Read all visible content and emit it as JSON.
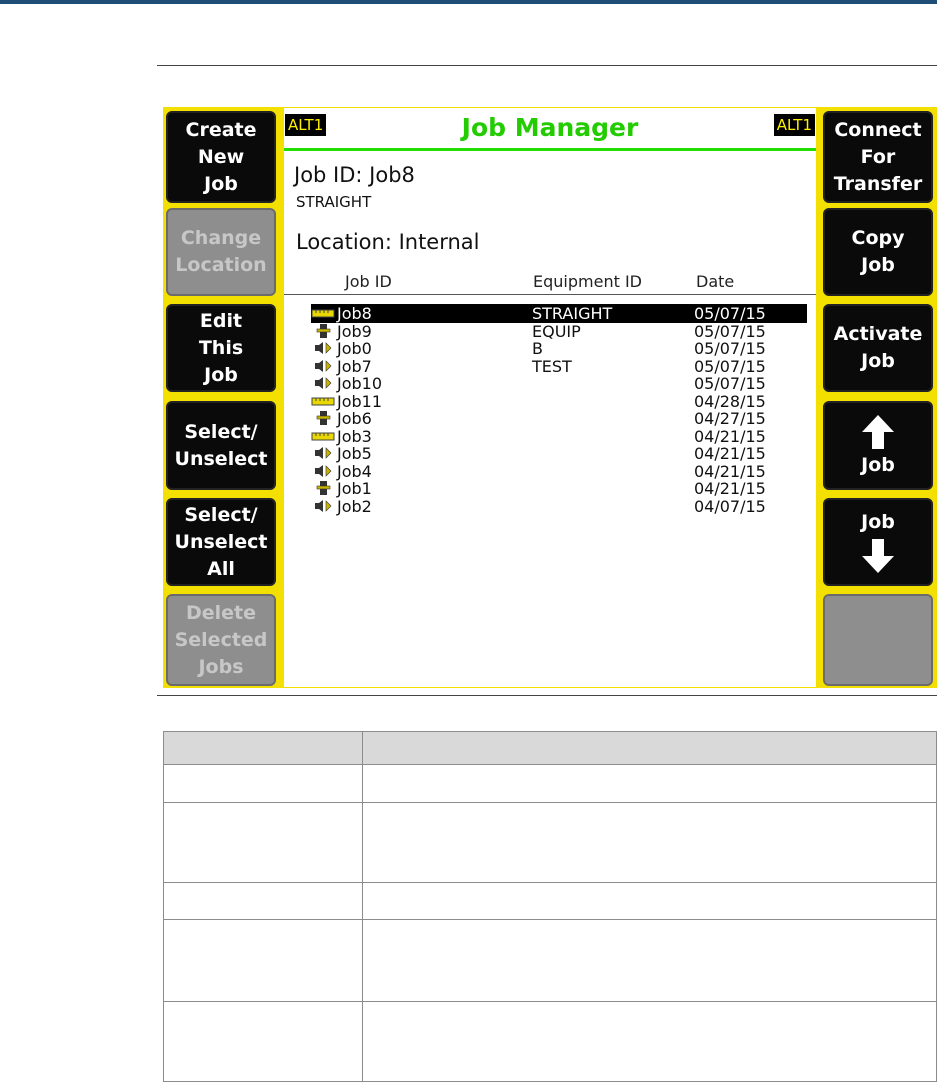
{
  "screen": {
    "alt_left": "ALT1",
    "alt_right": "ALT1",
    "title": "Job Manager",
    "job_id": "Job ID: Job8",
    "equipment": "STRAIGHT",
    "location": "Location: Internal",
    "columns": {
      "job_id": "Job ID",
      "equipment_id": "Equipment ID",
      "date": "Date"
    },
    "jobs": [
      {
        "name": "Job8",
        "equipment": "STRAIGHT",
        "date": "05/07/15",
        "icon": "ruler-icon",
        "selected": true
      },
      {
        "name": "Job9",
        "equipment": "EQUIP",
        "date": "05/07/15",
        "icon": "probe-icon",
        "selected": false
      },
      {
        "name": "Job0",
        "equipment": "B",
        "date": "05/07/15",
        "icon": "speaker-icon",
        "selected": false
      },
      {
        "name": "Job7",
        "equipment": "TEST",
        "date": "05/07/15",
        "icon": "speaker-icon",
        "selected": false
      },
      {
        "name": "Job10",
        "equipment": "",
        "date": "05/07/15",
        "icon": "speaker-icon",
        "selected": false
      },
      {
        "name": "Job11",
        "equipment": "",
        "date": "04/28/15",
        "icon": "ruler-icon",
        "selected": false
      },
      {
        "name": "Job6",
        "equipment": "",
        "date": "04/27/15",
        "icon": "probe-icon",
        "selected": false
      },
      {
        "name": "Job3",
        "equipment": "",
        "date": "04/21/15",
        "icon": "ruler-icon",
        "selected": false
      },
      {
        "name": "Job5",
        "equipment": "",
        "date": "04/21/15",
        "icon": "speaker-icon",
        "selected": false
      },
      {
        "name": "Job4",
        "equipment": "",
        "date": "04/21/15",
        "icon": "speaker-icon",
        "selected": false
      },
      {
        "name": "Job1",
        "equipment": "",
        "date": "04/21/15",
        "icon": "probe-icon",
        "selected": false
      },
      {
        "name": "Job2",
        "equipment": "",
        "date": "04/07/15",
        "icon": "speaker-icon",
        "selected": false
      }
    ]
  },
  "left_keys": {
    "create_new_job": [
      "Create",
      "New",
      "Job"
    ],
    "change_location": [
      "Change",
      "Location"
    ],
    "edit_this_job": [
      "Edit",
      "This",
      "Job"
    ],
    "select_unselect": [
      "Select/",
      "Unselect"
    ],
    "select_unselect_all": [
      "Select/",
      "Unselect",
      "All"
    ],
    "delete_selected_jobs": [
      "Delete",
      "Selected",
      "Jobs"
    ]
  },
  "right_keys": {
    "connect_for_transfer": [
      "Connect",
      "For",
      "Transfer"
    ],
    "copy_job": [
      "Copy",
      "Job"
    ],
    "activate_job": [
      "Activate",
      "Job"
    ],
    "job_up": "Job",
    "job_down": "Job"
  },
  "colors": {
    "bezel_yellow": "#f4e000",
    "title_green": "#22cc00",
    "softkey_black": "#0a0a0a",
    "softkey_disabled": "#8e8e8e",
    "header_band": "#1e4e75"
  }
}
